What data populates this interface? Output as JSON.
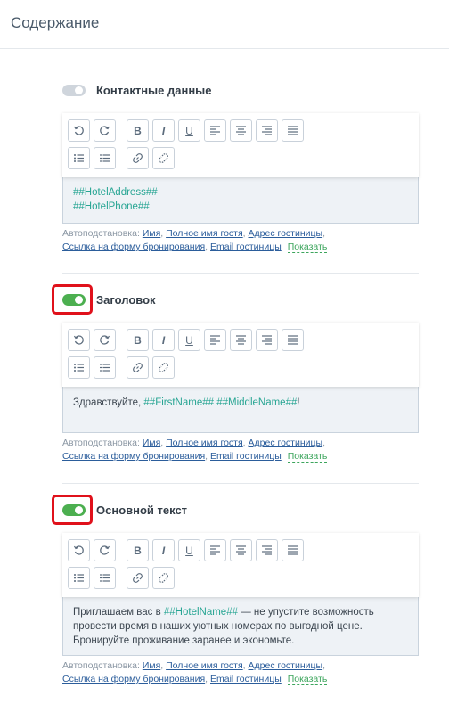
{
  "page_title": "Содержание",
  "toolbar": {
    "undo": "↺",
    "redo": "↻",
    "bold": "B",
    "italic": "I",
    "underline": "U",
    "align_left_icon": "align-left-icon",
    "align_center_icon": "align-center-icon",
    "align_right_icon": "align-right-icon",
    "align_justify_icon": "align-justify-icon",
    "bullet_list_icon": "bullet-list-icon",
    "numbered_list_icon": "numbered-list-icon",
    "link_icon": "link-icon",
    "unlink_icon": "unlink-icon"
  },
  "autosub": {
    "label": "Автоподстановка:",
    "items": [
      "Имя",
      "Полное имя гостя",
      "Адрес гостиницы",
      "Ссылка на форму бронирования",
      "Email гостиницы"
    ],
    "show": "Показать"
  },
  "sections": [
    {
      "label": "Контактные данные",
      "enabled": false,
      "highlighted": false,
      "lines": [
        "##HotelAddress##",
        "##HotelPhone##"
      ]
    },
    {
      "label": "Заголовок",
      "enabled": true,
      "highlighted": true,
      "text_prefix": "Здравствуйте, ",
      "tag1": "##FirstName##",
      "tag2": "##MiddleName##",
      "text_suffix": "!"
    },
    {
      "label": "Основной текст",
      "enabled": true,
      "highlighted": true,
      "text_prefix": "Приглашаем вас в ",
      "tag1": "##HotelName##",
      "text_suffix": " — не упустите возможность провести время в наших уютных номерах по выгодной цене. Бронируйте проживание заранее и экономьте."
    }
  ],
  "colors": {
    "toggle_on": "#4caf50",
    "toggle_off": "#cfd5dc",
    "highlight": "#e0111b",
    "tag": "#27a593",
    "link": "#2b5d9b"
  }
}
